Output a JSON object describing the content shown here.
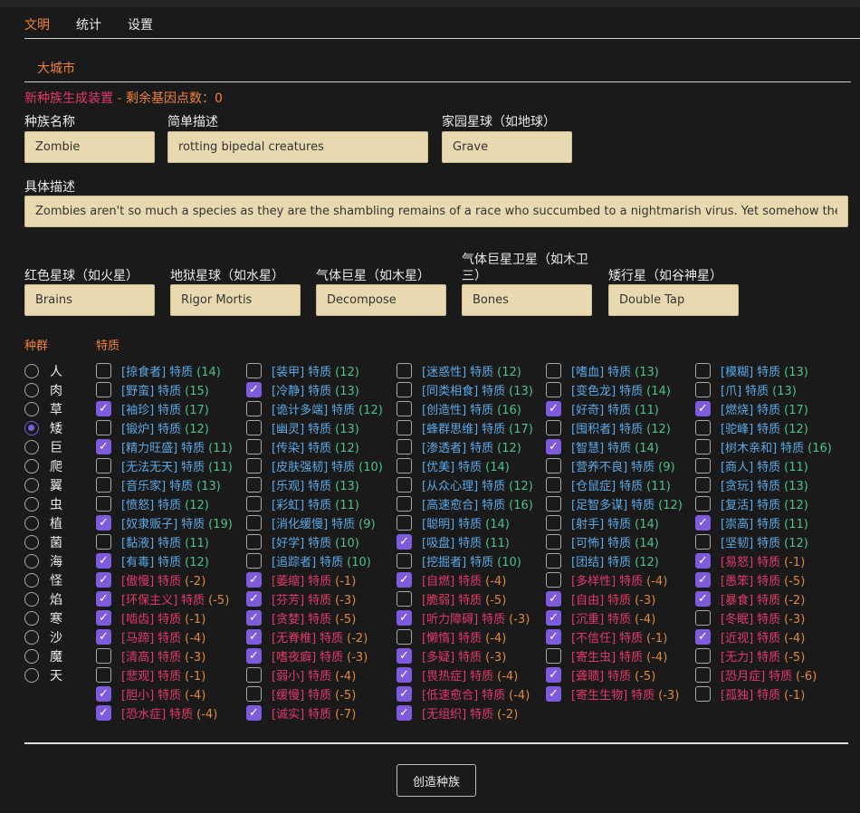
{
  "nav": {
    "tabs": [
      "文明",
      "统计",
      "设置"
    ],
    "active": 0,
    "sub_tab": "大城市"
  },
  "generator": {
    "title": "新种族生成装置",
    "dash": " - ",
    "points_label": "剩余基因点数：",
    "points": "0"
  },
  "fields": {
    "name": {
      "label": "种族名称",
      "value": "Zombie"
    },
    "desc": {
      "label": "简单描述",
      "value": "rotting bipedal creatures"
    },
    "home": {
      "label": "家园星球（如地球）",
      "value": "Grave"
    },
    "detail": {
      "label": "具体描述",
      "value": "Zombies aren't so much a species as they are the shambling remains of a race who succumbed to a nightmarish virus. Yet somehow they continue to exist."
    },
    "red": {
      "label": "红色星球（如火星）",
      "value": "Brains"
    },
    "hell": {
      "label": "地狱星球（如水星）",
      "value": "Rigor Mortis"
    },
    "gas": {
      "label": "气体巨星（如木星）",
      "value": "Decompose"
    },
    "moon": {
      "label": "气体巨星卫星（如木卫三）",
      "value": "Bones"
    },
    "dwarf": {
      "label": "矮行星（如谷神星）",
      "value": "Double Tap"
    }
  },
  "species_header": "种群",
  "traits_header": "特质",
  "species": {
    "items": [
      "人",
      "肉",
      "草",
      "矮",
      "巨",
      "爬",
      "翼",
      "虫",
      "植",
      "菌",
      "海",
      "怪",
      "焰",
      "寒",
      "沙",
      "魔",
      "天"
    ],
    "selected": 3
  },
  "traits": {
    "word": "特质",
    "columns": [
      [
        {
          "name": "[掠食者]",
          "pts": "(14)",
          "on": false
        },
        {
          "name": "[野蛮]",
          "pts": "(15)",
          "on": false
        },
        {
          "name": "[袖珍]",
          "pts": "(17)",
          "on": true
        },
        {
          "name": "[锻炉]",
          "pts": "(12)",
          "on": false
        },
        {
          "name": "[精力旺盛]",
          "pts": "(11)",
          "on": true
        },
        {
          "name": "[无法无天]",
          "pts": "(11)",
          "on": false
        },
        {
          "name": "[音乐家]",
          "pts": "(13)",
          "on": false
        },
        {
          "name": "[愤怒]",
          "pts": "(12)",
          "on": false
        },
        {
          "name": "[奴隶贩子]",
          "pts": "(19)",
          "on": true
        },
        {
          "name": "[黏液]",
          "pts": "(11)",
          "on": false
        },
        {
          "name": "[有毒]",
          "pts": "(12)",
          "on": true
        },
        {
          "name": "[傲慢]",
          "pts": "(-2)",
          "on": true,
          "neg": true
        },
        {
          "name": "[环保主义]",
          "pts": "(-5)",
          "on": true,
          "neg": true
        },
        {
          "name": "[啮齿]",
          "pts": "(-1)",
          "on": true,
          "neg": true
        },
        {
          "name": "[马蹄]",
          "pts": "(-4)",
          "on": true,
          "neg": true
        },
        {
          "name": "[清高]",
          "pts": "(-3)",
          "on": false,
          "neg": true
        },
        {
          "name": "[悲观]",
          "pts": "(-1)",
          "on": false,
          "neg": true
        },
        {
          "name": "[胆小]",
          "pts": "(-4)",
          "on": true,
          "neg": true
        },
        {
          "name": "[恐水症]",
          "pts": "(-4)",
          "on": true,
          "neg": true
        }
      ],
      [
        {
          "name": "[装甲]",
          "pts": "(12)",
          "on": false
        },
        {
          "name": "[冷静]",
          "pts": "(13)",
          "on": true
        },
        {
          "name": "[诡计多端]",
          "pts": "(12)",
          "on": false
        },
        {
          "name": "[幽灵]",
          "pts": "(13)",
          "on": false
        },
        {
          "name": "[传染]",
          "pts": "(12)",
          "on": false
        },
        {
          "name": "[皮肤强韧]",
          "pts": "(10)",
          "on": false
        },
        {
          "name": "[乐观]",
          "pts": "(13)",
          "on": false
        },
        {
          "name": "[彩虹]",
          "pts": "(11)",
          "on": false
        },
        {
          "name": "[消化缓慢]",
          "pts": "(9)",
          "on": false
        },
        {
          "name": "[好学]",
          "pts": "(10)",
          "on": false
        },
        {
          "name": "[追踪者]",
          "pts": "(10)",
          "on": false
        },
        {
          "name": "[萎缩]",
          "pts": "(-1)",
          "on": true,
          "neg": true
        },
        {
          "name": "[芬芳]",
          "pts": "(-3)",
          "on": true,
          "neg": true
        },
        {
          "name": "[贪婪]",
          "pts": "(-5)",
          "on": true,
          "neg": true
        },
        {
          "name": "[无脊椎]",
          "pts": "(-2)",
          "on": true,
          "neg": true
        },
        {
          "name": "[嗜夜癖]",
          "pts": "(-3)",
          "on": true,
          "neg": true
        },
        {
          "name": "[弱小]",
          "pts": "(-4)",
          "on": false,
          "neg": true
        },
        {
          "name": "[缓慢]",
          "pts": "(-5)",
          "on": false,
          "neg": true
        },
        {
          "name": "[诚实]",
          "pts": "(-7)",
          "on": true,
          "neg": true
        }
      ],
      [
        {
          "name": "[迷惑性]",
          "pts": "(12)",
          "on": false
        },
        {
          "name": "[同类相食]",
          "pts": "(13)",
          "on": false
        },
        {
          "name": "[创造性]",
          "pts": "(16)",
          "on": false
        },
        {
          "name": "[蜂群思维]",
          "pts": "(17)",
          "on": false
        },
        {
          "name": "[渗透者]",
          "pts": "(12)",
          "on": false
        },
        {
          "name": "[优美]",
          "pts": "(14)",
          "on": false
        },
        {
          "name": "[从众心理]",
          "pts": "(12)",
          "on": false
        },
        {
          "name": "[高速愈合]",
          "pts": "(16)",
          "on": false
        },
        {
          "name": "[聪明]",
          "pts": "(14)",
          "on": false
        },
        {
          "name": "[吸盘]",
          "pts": "(11)",
          "on": true
        },
        {
          "name": "[挖掘者]",
          "pts": "(10)",
          "on": false
        },
        {
          "name": "[自燃]",
          "pts": "(-4)",
          "on": true,
          "neg": true
        },
        {
          "name": "[脆弱]",
          "pts": "(-5)",
          "on": false,
          "neg": true
        },
        {
          "name": "[听力障碍]",
          "pts": "(-3)",
          "on": true,
          "neg": true
        },
        {
          "name": "[懒惰]",
          "pts": "(-4)",
          "on": false,
          "neg": true
        },
        {
          "name": "[多疑]",
          "pts": "(-3)",
          "on": true,
          "neg": true
        },
        {
          "name": "[畏热症]",
          "pts": "(-4)",
          "on": true,
          "neg": true
        },
        {
          "name": "[低速愈合]",
          "pts": "(-4)",
          "on": true,
          "neg": true
        },
        {
          "name": "[无组织]",
          "pts": "(-2)",
          "on": true,
          "neg": true
        }
      ],
      [
        {
          "name": "[嗜血]",
          "pts": "(13)",
          "on": false
        },
        {
          "name": "[变色龙]",
          "pts": "(14)",
          "on": false
        },
        {
          "name": "[好奇]",
          "pts": "(11)",
          "on": true
        },
        {
          "name": "[囤积者]",
          "pts": "(12)",
          "on": false
        },
        {
          "name": "[智慧]",
          "pts": "(14)",
          "on": true
        },
        {
          "name": "[营养不良]",
          "pts": "(9)",
          "on": false
        },
        {
          "name": "[仓鼠症]",
          "pts": "(11)",
          "on": false
        },
        {
          "name": "[足智多谋]",
          "pts": "(12)",
          "on": false
        },
        {
          "name": "[射手]",
          "pts": "(14)",
          "on": false
        },
        {
          "name": "[可怖]",
          "pts": "(14)",
          "on": false
        },
        {
          "name": "[团结]",
          "pts": "(12)",
          "on": false
        },
        {
          "name": "[多样性]",
          "pts": "(-4)",
          "on": false,
          "neg": true
        },
        {
          "name": "[自由]",
          "pts": "(-3)",
          "on": true,
          "neg": true
        },
        {
          "name": "[沉重]",
          "pts": "(-4)",
          "on": true,
          "neg": true
        },
        {
          "name": "[不信任]",
          "pts": "(-1)",
          "on": true,
          "neg": true
        },
        {
          "name": "[寄生虫]",
          "pts": "(-4)",
          "on": false,
          "neg": true
        },
        {
          "name": "[聋聩]",
          "pts": "(-5)",
          "on": true,
          "neg": true
        },
        {
          "name": "[寄生生物]",
          "pts": "(-3)",
          "on": true,
          "neg": true
        }
      ],
      [
        {
          "name": "[模糊]",
          "pts": "(13)",
          "on": false
        },
        {
          "name": "[爪]",
          "pts": "(13)",
          "on": false
        },
        {
          "name": "[燃烧]",
          "pts": "(17)",
          "on": true
        },
        {
          "name": "[驼峰]",
          "pts": "(12)",
          "on": false
        },
        {
          "name": "[树木亲和]",
          "pts": "(16)",
          "on": false
        },
        {
          "name": "[商人]",
          "pts": "(11)",
          "on": false
        },
        {
          "name": "[贪玩]",
          "pts": "(13)",
          "on": false
        },
        {
          "name": "[复活]",
          "pts": "(12)",
          "on": false
        },
        {
          "name": "[崇高]",
          "pts": "(11)",
          "on": true
        },
        {
          "name": "[坚韧]",
          "pts": "(12)",
          "on": false
        },
        {
          "name": "[易怒]",
          "pts": "(-1)",
          "on": true,
          "neg": true
        },
        {
          "name": "[愚笨]",
          "pts": "(-5)",
          "on": true,
          "neg": true
        },
        {
          "name": "[暴食]",
          "pts": "(-2)",
          "on": true,
          "neg": true
        },
        {
          "name": "[冬眠]",
          "pts": "(-3)",
          "on": false,
          "neg": true
        },
        {
          "name": "[近视]",
          "pts": "(-4)",
          "on": true,
          "neg": true
        },
        {
          "name": "[无力]",
          "pts": "(-5)",
          "on": false,
          "neg": true
        },
        {
          "name": "[恐月症]",
          "pts": "(-6)",
          "on": false,
          "neg": true
        },
        {
          "name": "[孤独]",
          "pts": "(-1)",
          "on": false,
          "neg": true
        }
      ]
    ]
  },
  "create_button": "创造种族"
}
